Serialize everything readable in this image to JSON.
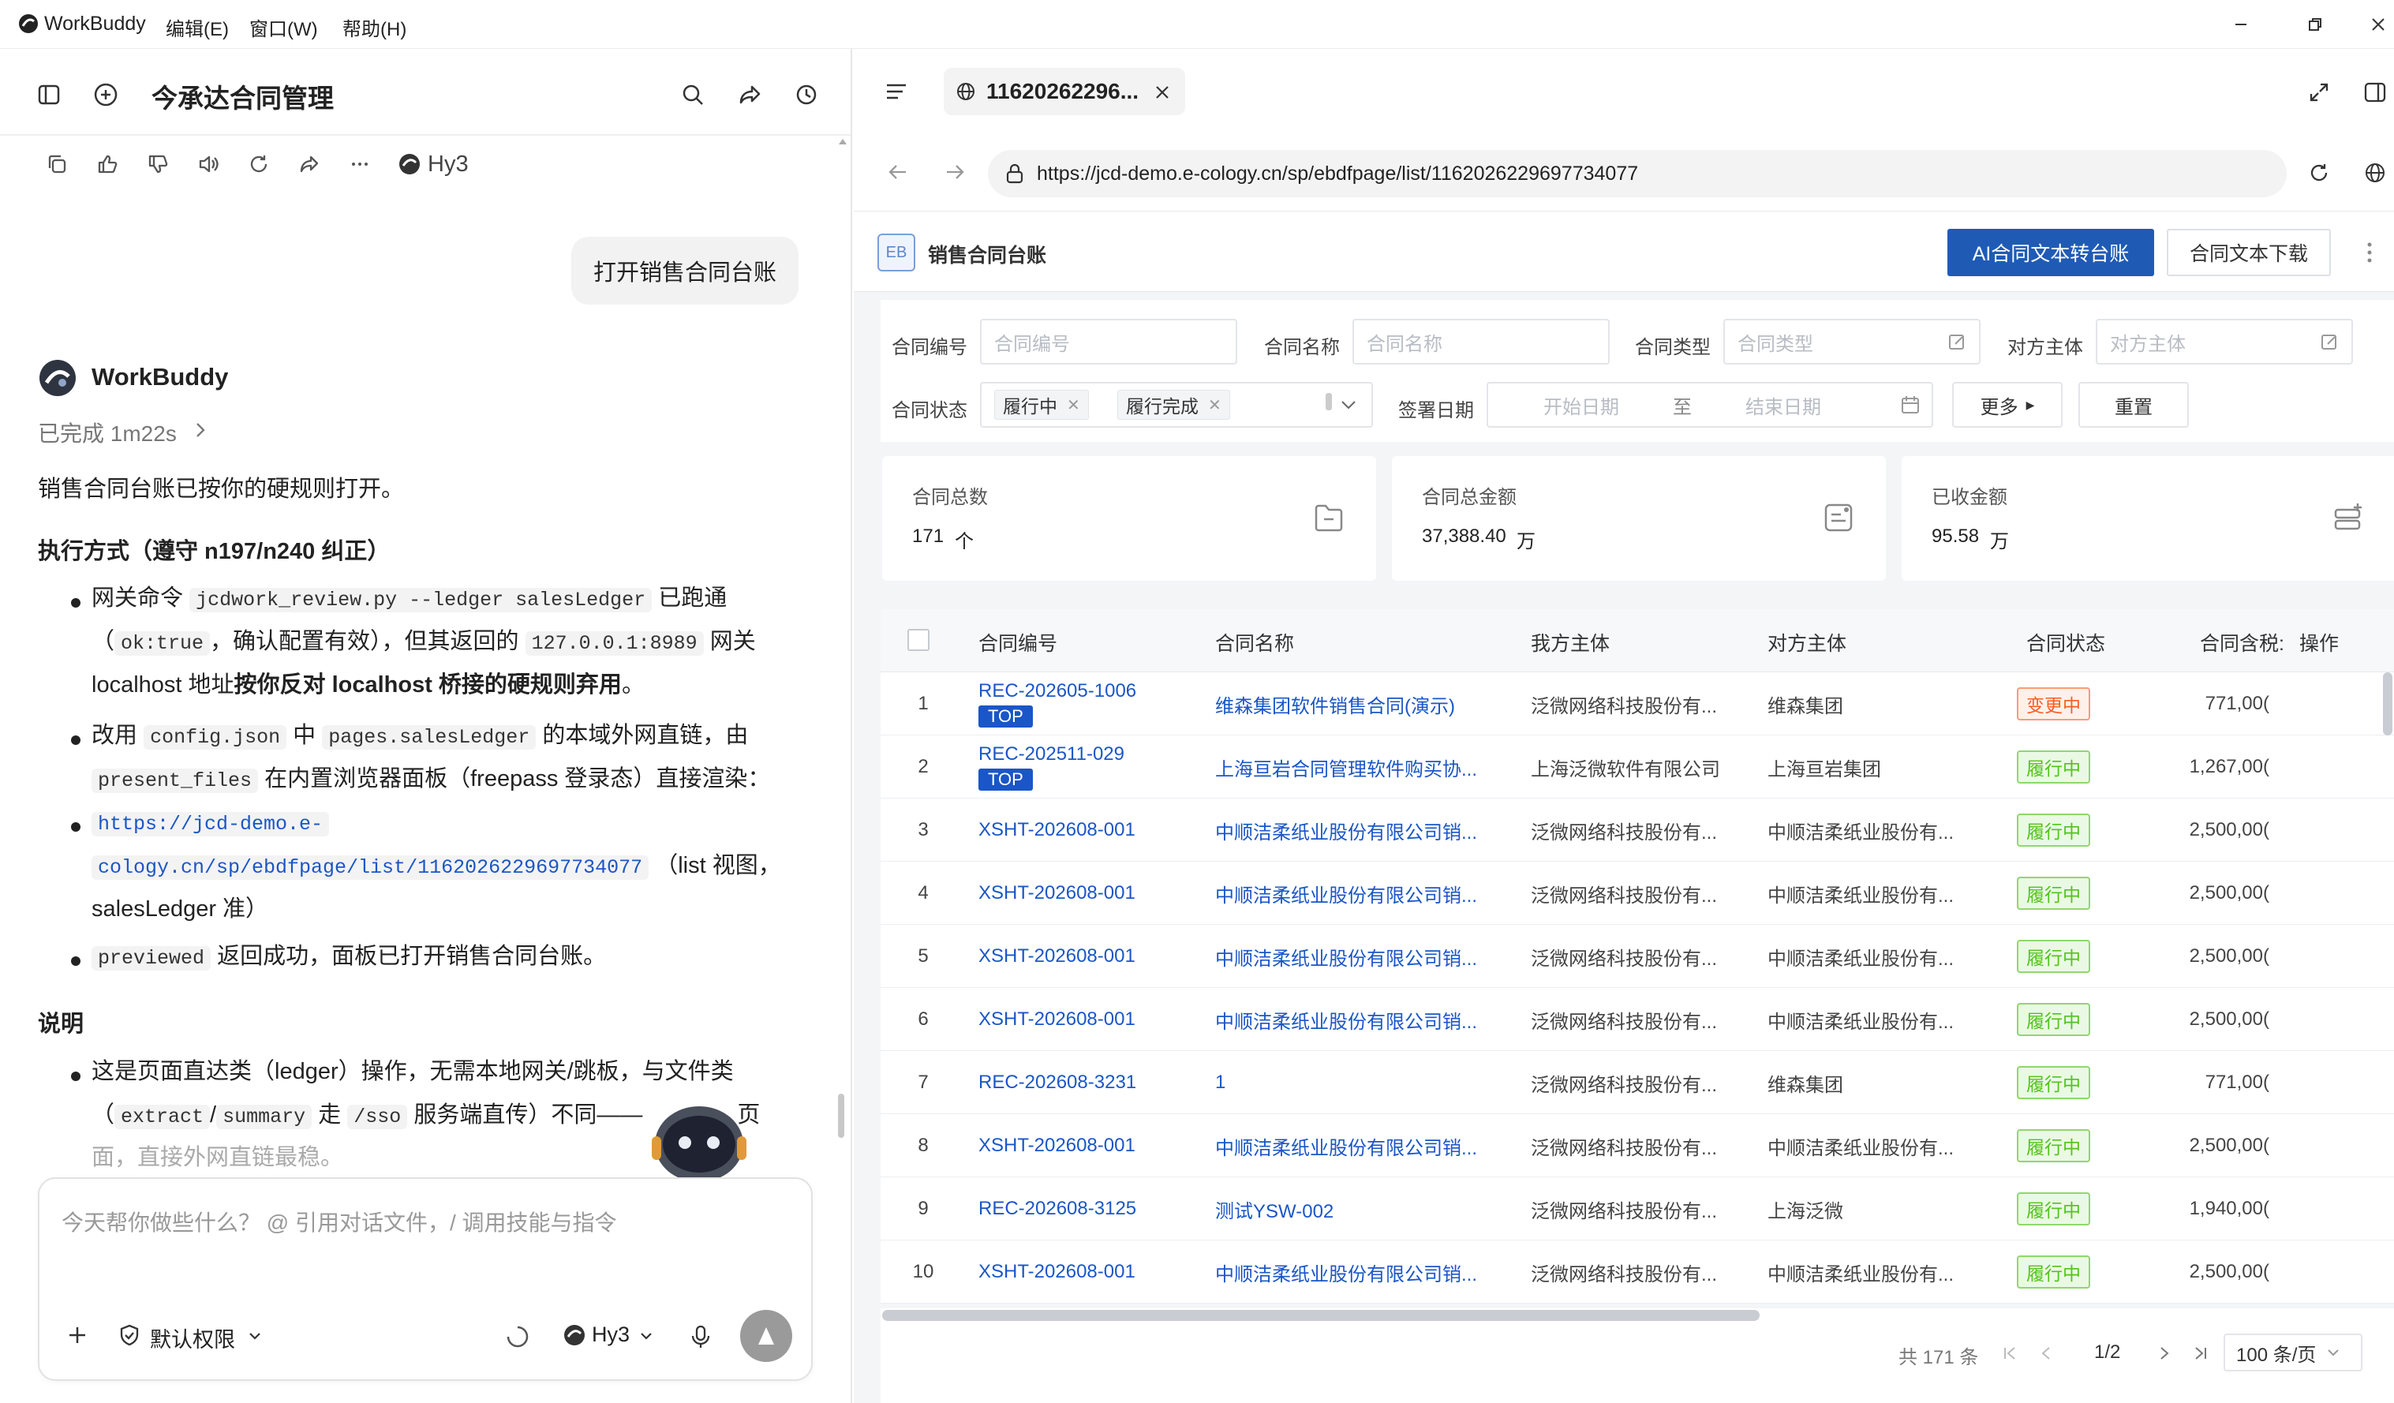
{
  "titlebar": {
    "app_name": "WorkBuddy",
    "menu": [
      "编辑(E)",
      "窗口(W)",
      "帮助(H)"
    ]
  },
  "chat": {
    "title": "今承达合同管理",
    "model_label": "Hy3",
    "user_message": "打开销售合同台账",
    "assistant_name": "WorkBuddy",
    "status": "已完成 1m22s",
    "lines": {
      "intro": "销售合同台账已按你的硬规则打开。",
      "h1": "执行方式（遵守 n197/n240 纠正）",
      "b1_1a": "网关命令",
      "b1_1code": "jcdwork_review.py --ledger salesLedger",
      "b1_1b": "已跑通",
      "b1_2a": "（",
      "b1_2code": "ok:true",
      "b1_2b": "，确认配置有效），但其返回的",
      "b1_2code2": "127.0.0.1:8989",
      "b1_2c": "网关",
      "b1_3a": "localhost 地址",
      "b1_3b": "按你反对 localhost 桥接的硬规则弃用",
      "b1_3c": "。",
      "b2_1a": "改用",
      "b2_1code": "config.json",
      "b2_1b": "中",
      "b2_1code2": "pages.salesLedger",
      "b2_1c": "的本域外网直链，由",
      "b2_2code": "present_files",
      "b2_2b": "在内置浏览器面板（freepass 登录态）直接渲染：",
      "b3_1": "https://jcd-demo.e-",
      "b3_2": "cology.cn/sp/ebdfpage/list/1162026229697734077",
      "b3_2b": "（list 视图，",
      "b3_3": "salesLedger 准）",
      "b4_code": "previewed",
      "b4_b": "返回成功，面板已打开销售合同台账。",
      "h2": "说明",
      "b5_1": "这是页面直达类（ledger）操作，无需本地网关/跳板，与文件类",
      "b5_2a": "（",
      "b5_2code": "extract",
      "b5_2sep": "/",
      "b5_2code2": "summary",
      "b5_2b": "走",
      "b5_2code3": "/sso",
      "b5_2c": "服务端直传）不同——",
      "b5_2d": "页",
      "b5_3": "面，直接外网直链最稳。"
    },
    "input_placeholder": "今天帮你做些什么？ @ 引用对话文件，/ 调用技能与指令",
    "permission_label": "默认权限",
    "input_model": "Hy3"
  },
  "browser": {
    "tab_title": "11620262296...",
    "url": "https://jcd-demo.e-cology.cn/sp/ebdfpage/list/1162026229697734077"
  },
  "ledger": {
    "badge": "EB",
    "title": "销售合同台账",
    "btn_ai": "AI合同文本转台账",
    "btn_download": "合同文本下载",
    "filters": {
      "contract_no_label": "合同编号",
      "contract_no_ph": "合同编号",
      "contract_name_label": "合同名称",
      "contract_name_ph": "合同名称",
      "contract_type_label": "合同类型",
      "contract_type_ph": "合同类型",
      "counterparty_label": "对方主体",
      "counterparty_ph": "对方主体",
      "status_label": "合同状态",
      "status_tags": [
        "履行中",
        "履行完成"
      ],
      "sign_date_label": "签署日期",
      "start_ph": "开始日期",
      "to": "至",
      "end_ph": "结束日期",
      "more": "更多",
      "reset": "重置"
    },
    "stats": [
      {
        "label": "合同总数",
        "value": "171",
        "unit": "个"
      },
      {
        "label": "合同总金额",
        "value": "37,388.40",
        "unit": "万"
      },
      {
        "label": "已收金额",
        "value": "95.58",
        "unit": "万"
      }
    ],
    "columns": [
      "合同编号",
      "合同名称",
      "我方主体",
      "对方主体",
      "合同状态",
      "合同含税:",
      "操作"
    ],
    "rows": [
      {
        "idx": "1",
        "no": "REC-202605-1006",
        "top": "TOP",
        "name": "维森集团软件销售合同(演示)",
        "our": "泛微网络科技股份有...",
        "other": "维森集团",
        "status": "变更中",
        "status_type": "red",
        "amount": "771,00("
      },
      {
        "idx": "2",
        "no": "REC-202511-029",
        "top": "TOP",
        "name": "上海亘岩合同管理软件购买协...",
        "our": "上海泛微软件有限公司",
        "other": "上海亘岩集团",
        "status": "履行中",
        "status_type": "green",
        "amount": "1,267,00("
      },
      {
        "idx": "3",
        "no": "XSHT-202608-001",
        "top": "",
        "name": "中顺洁柔纸业股份有限公司销...",
        "our": "泛微网络科技股份有...",
        "other": "中顺洁柔纸业股份有...",
        "status": "履行中",
        "status_type": "green",
        "amount": "2,500,00("
      },
      {
        "idx": "4",
        "no": "XSHT-202608-001",
        "top": "",
        "name": "中顺洁柔纸业股份有限公司销...",
        "our": "泛微网络科技股份有...",
        "other": "中顺洁柔纸业股份有...",
        "status": "履行中",
        "status_type": "green",
        "amount": "2,500,00("
      },
      {
        "idx": "5",
        "no": "XSHT-202608-001",
        "top": "",
        "name": "中顺洁柔纸业股份有限公司销...",
        "our": "泛微网络科技股份有...",
        "other": "中顺洁柔纸业股份有...",
        "status": "履行中",
        "status_type": "green",
        "amount": "2,500,00("
      },
      {
        "idx": "6",
        "no": "XSHT-202608-001",
        "top": "",
        "name": "中顺洁柔纸业股份有限公司销...",
        "our": "泛微网络科技股份有...",
        "other": "中顺洁柔纸业股份有...",
        "status": "履行中",
        "status_type": "green",
        "amount": "2,500,00("
      },
      {
        "idx": "7",
        "no": "REC-202608-3231",
        "top": "",
        "name": "1",
        "our": "泛微网络科技股份有...",
        "other": "维森集团",
        "status": "履行中",
        "status_type": "green",
        "amount": "771,00("
      },
      {
        "idx": "8",
        "no": "XSHT-202608-001",
        "top": "",
        "name": "中顺洁柔纸业股份有限公司销...",
        "our": "泛微网络科技股份有...",
        "other": "中顺洁柔纸业股份有...",
        "status": "履行中",
        "status_type": "green",
        "amount": "2,500,00("
      },
      {
        "idx": "9",
        "no": "REC-202608-3125",
        "top": "",
        "name": "测试YSW-002",
        "our": "泛微网络科技股份有...",
        "other": "上海泛微",
        "status": "履行中",
        "status_type": "green",
        "amount": "1,940,00("
      },
      {
        "idx": "10",
        "no": "XSHT-202608-001",
        "top": "",
        "name": "中顺洁柔纸业股份有限公司销...",
        "our": "泛微网络科技股份有...",
        "other": "中顺洁柔纸业股份有...",
        "status": "履行中",
        "status_type": "green",
        "amount": "2,500,00("
      }
    ],
    "pagination": {
      "total": "共 171 条",
      "page": "1/2",
      "page_size": "100 条/页"
    }
  }
}
